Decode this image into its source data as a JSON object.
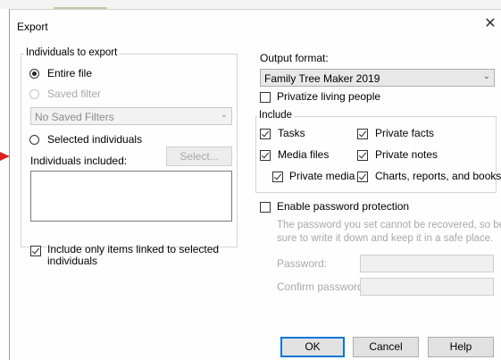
{
  "window": {
    "title": "Export",
    "close_glyph": "✕"
  },
  "individuals": {
    "group_label": "Individuals to export",
    "entire_file": "Entire file",
    "saved_filter": "Saved filter",
    "saved_filter_value": "No Saved Filters",
    "selected_individuals": "Selected individuals",
    "included_label": "Individuals included:",
    "select_button": "Select...",
    "linked_only": "Include only items linked  to selected individuals"
  },
  "output": {
    "label": "Output format:",
    "format_value": "Family Tree Maker 2019",
    "privatize": "Privatize living people"
  },
  "include": {
    "group_label": "Include",
    "tasks": "Tasks",
    "private_facts": "Private facts",
    "media_files": "Media files",
    "private_notes": "Private notes",
    "private_media": "Private media",
    "charts": "Charts, reports, and books"
  },
  "password": {
    "enable": "Enable password protection",
    "note": "The password you set cannot be recovered, so be sure to write it down and keep it in a safe place.",
    "password_label": "Password:",
    "confirm_label": "Confirm password:"
  },
  "buttons": {
    "ok": "OK",
    "cancel": "Cancel",
    "help": "Help"
  },
  "icons": {
    "close": "close-icon",
    "chevron": "chevron-down-icon",
    "pointer": "red-arrow-marker"
  },
  "colors": {
    "primary_border": "#0078d7",
    "arrow": "#e02020"
  }
}
